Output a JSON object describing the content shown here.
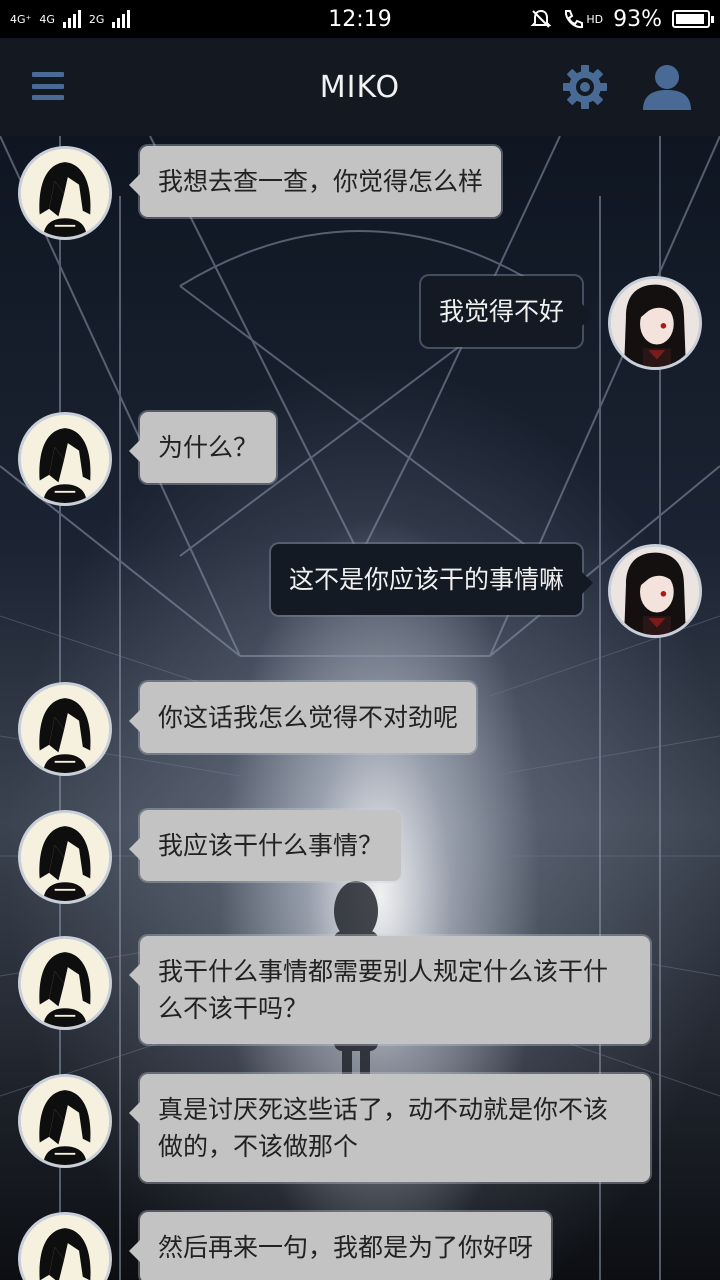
{
  "status_bar": {
    "network_labels": [
      "4G⁺",
      "4G",
      "2G"
    ],
    "time": "12:19",
    "hd_label": "HD",
    "battery_percent_text": "93%",
    "battery_level": 0.93
  },
  "app_bar": {
    "title": "MIKO",
    "icons": [
      "menu-icon",
      "gear-icon",
      "user-icon"
    ],
    "accent_color": "#4a6a96"
  },
  "messages": [
    {
      "side": "left",
      "avatar": "bob-hair-avatar",
      "text": "我想去查一查，你觉得怎么样"
    },
    {
      "side": "right",
      "avatar": "long-hair-avatar",
      "text": "我觉得不好"
    },
    {
      "side": "left",
      "avatar": "bob-hair-avatar",
      "text": "为什么？"
    },
    {
      "side": "right",
      "avatar": "long-hair-avatar",
      "text": "这不是你应该干的事情嘛"
    },
    {
      "side": "left",
      "avatar": "bob-hair-avatar",
      "text": "你这话我怎么觉得不对劲呢"
    },
    {
      "side": "left",
      "avatar": "bob-hair-avatar",
      "text": "我应该干什么事情？"
    },
    {
      "side": "left",
      "avatar": "bob-hair-avatar",
      "text": "我干什么事情都需要别人规定什么该干什么不该干吗？"
    },
    {
      "side": "left",
      "avatar": "bob-hair-avatar",
      "text": "真是讨厌死这些话了，动不动就是你不该做的，不该做那个"
    },
    {
      "side": "left",
      "avatar": "bob-hair-avatar",
      "text": "然后再来一句，我都是为了你好呀"
    }
  ]
}
